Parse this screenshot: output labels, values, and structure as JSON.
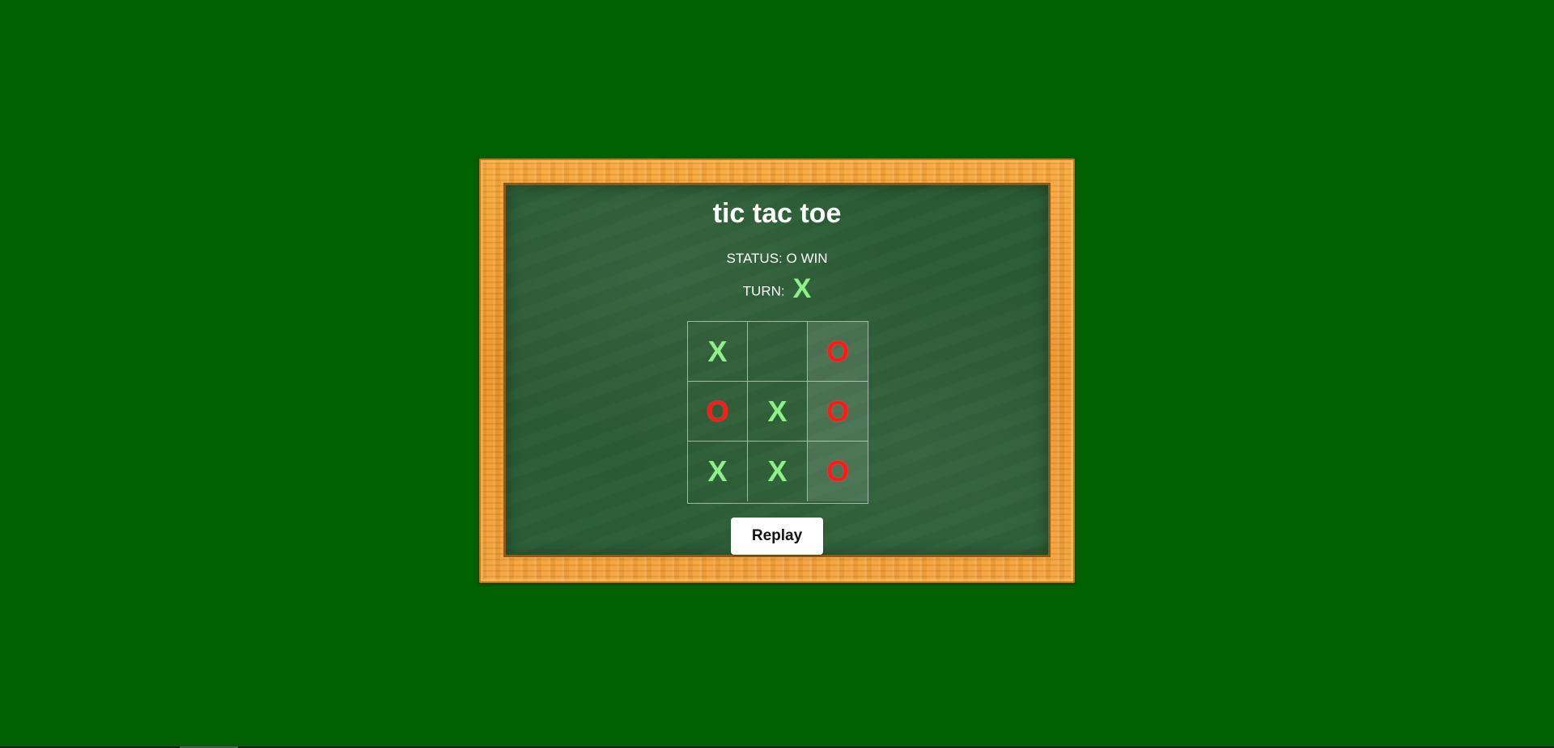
{
  "game": {
    "title": "tic tac toe",
    "status_label": "STATUS:",
    "status_value": "O WIN",
    "turn_label": "TURN:",
    "turn_value": "X",
    "replay_label": "Replay"
  },
  "board": {
    "cells": [
      "X",
      "",
      "O",
      "O",
      "X",
      "O",
      "X",
      "X",
      "O"
    ],
    "winning_cells": [
      2,
      5,
      8
    ]
  },
  "colors": {
    "background": "#006100",
    "x_mark": "#8ff08a",
    "o_mark": "#ff1a1a",
    "chalkboard": "#2a5c34",
    "frame_wood": "#f09a30"
  }
}
